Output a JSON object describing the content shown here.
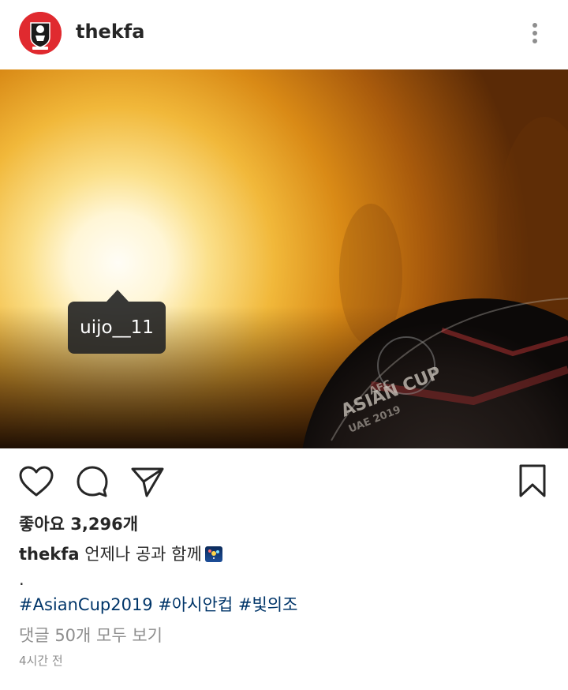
{
  "post": {
    "username": "thekfa",
    "tag_label": "uijo__11",
    "likes_text": "좋아요 3,296개",
    "caption_user": "thekfa",
    "caption_text": "언제나 공과 함께",
    "caption_emoji": "fireworks-emoji",
    "dot": ".",
    "hashtags": "#AsianCup2019 #아시안컵 #빛의조",
    "comments_link": "댓글 50개 모두 보기",
    "time_ago": "4시간 전"
  },
  "icons": {
    "avatar": "kfa-logo",
    "more": "more-vertical-icon",
    "like": "heart-icon",
    "comment": "comment-icon",
    "share": "send-icon",
    "save": "bookmark-icon",
    "user_tags": "person-icon"
  },
  "colors": {
    "brand_red": "#e02a2f",
    "link_blue": "#003569",
    "muted": "#8e8e8e",
    "text": "#262626"
  }
}
